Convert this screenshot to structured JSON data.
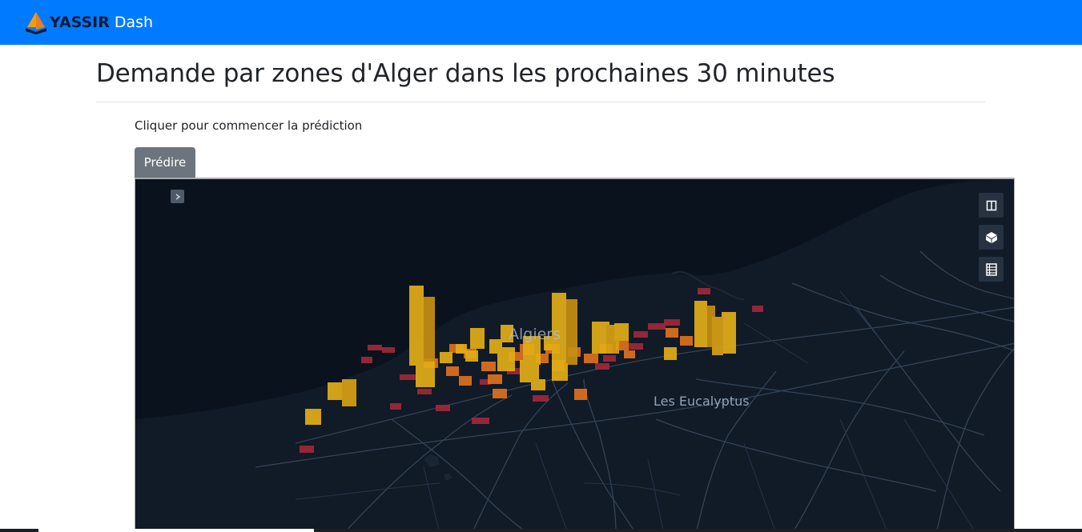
{
  "navbar": {
    "brand_name": "YASSIR",
    "brand_suffix": "Dash",
    "logo_icon": "yassir-cone-logo-icon",
    "background": "#007bff"
  },
  "page": {
    "title": "Demande par zones d'Alger dans les prochaines 30 minutes",
    "instruction": "Cliquer pour commencer la prédiction",
    "predict_button": "Prédire"
  },
  "map": {
    "labels": {
      "city": "Algiers",
      "district": "Les Eucalyptus"
    },
    "controls": {
      "toggle_icon": "chevron-right-icon",
      "split_view_icon": "split-view-icon",
      "perspective_icon": "3d-cube-icon",
      "legend_icon": "data-table-icon"
    },
    "colors": {
      "background": "#0b1420",
      "land": "#111a27",
      "sea": "#0a121d",
      "roads": "#36495d",
      "high_demand": "#e2ad17",
      "mid_demand": "#e2731f",
      "low_demand": "#a2293a"
    }
  }
}
